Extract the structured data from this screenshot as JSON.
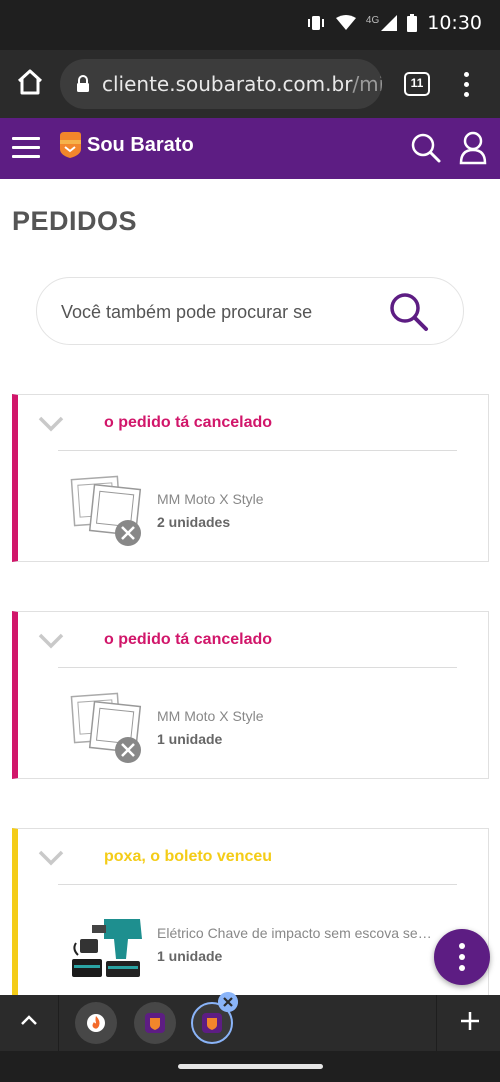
{
  "status_bar": {
    "time": "10:30",
    "network": "4G",
    "icons": [
      "vibrate-icon",
      "wifi-icon",
      "signal-icon",
      "battery-icon"
    ]
  },
  "browser": {
    "url_domain": "cliente.soubarato.com.br",
    "url_path": "/minha",
    "tab_count": "11"
  },
  "site": {
    "brand": "Sou Barato",
    "brand_color": "#5d1d83"
  },
  "page": {
    "title": "PEDIDOS"
  },
  "search": {
    "placeholder": "Você também pode procurar se"
  },
  "orders": [
    {
      "status": "o pedido tá cancelado",
      "status_color": "#d1166a",
      "item_name": "MM Moto X Style",
      "quantity": "2 unidades",
      "thumbnail": "image-unavailable-icon"
    },
    {
      "status": "o pedido tá cancelado",
      "status_color": "#d1166a",
      "item_name": "MM Moto X Style",
      "quantity": "1 unidade",
      "thumbnail": "image-unavailable-icon"
    },
    {
      "status": "poxa, o boleto venceu",
      "status_color": "#f4cc17",
      "item_name": "Elétrico Chave de impacto sem escova sem ...",
      "quantity": "1 unidade",
      "thumbnail": "impact-wrench-photo"
    }
  ],
  "bottom_bar": {
    "tabs": [
      "firefox-tab",
      "soubarato-tab",
      "soubarato-tab-active"
    ]
  }
}
